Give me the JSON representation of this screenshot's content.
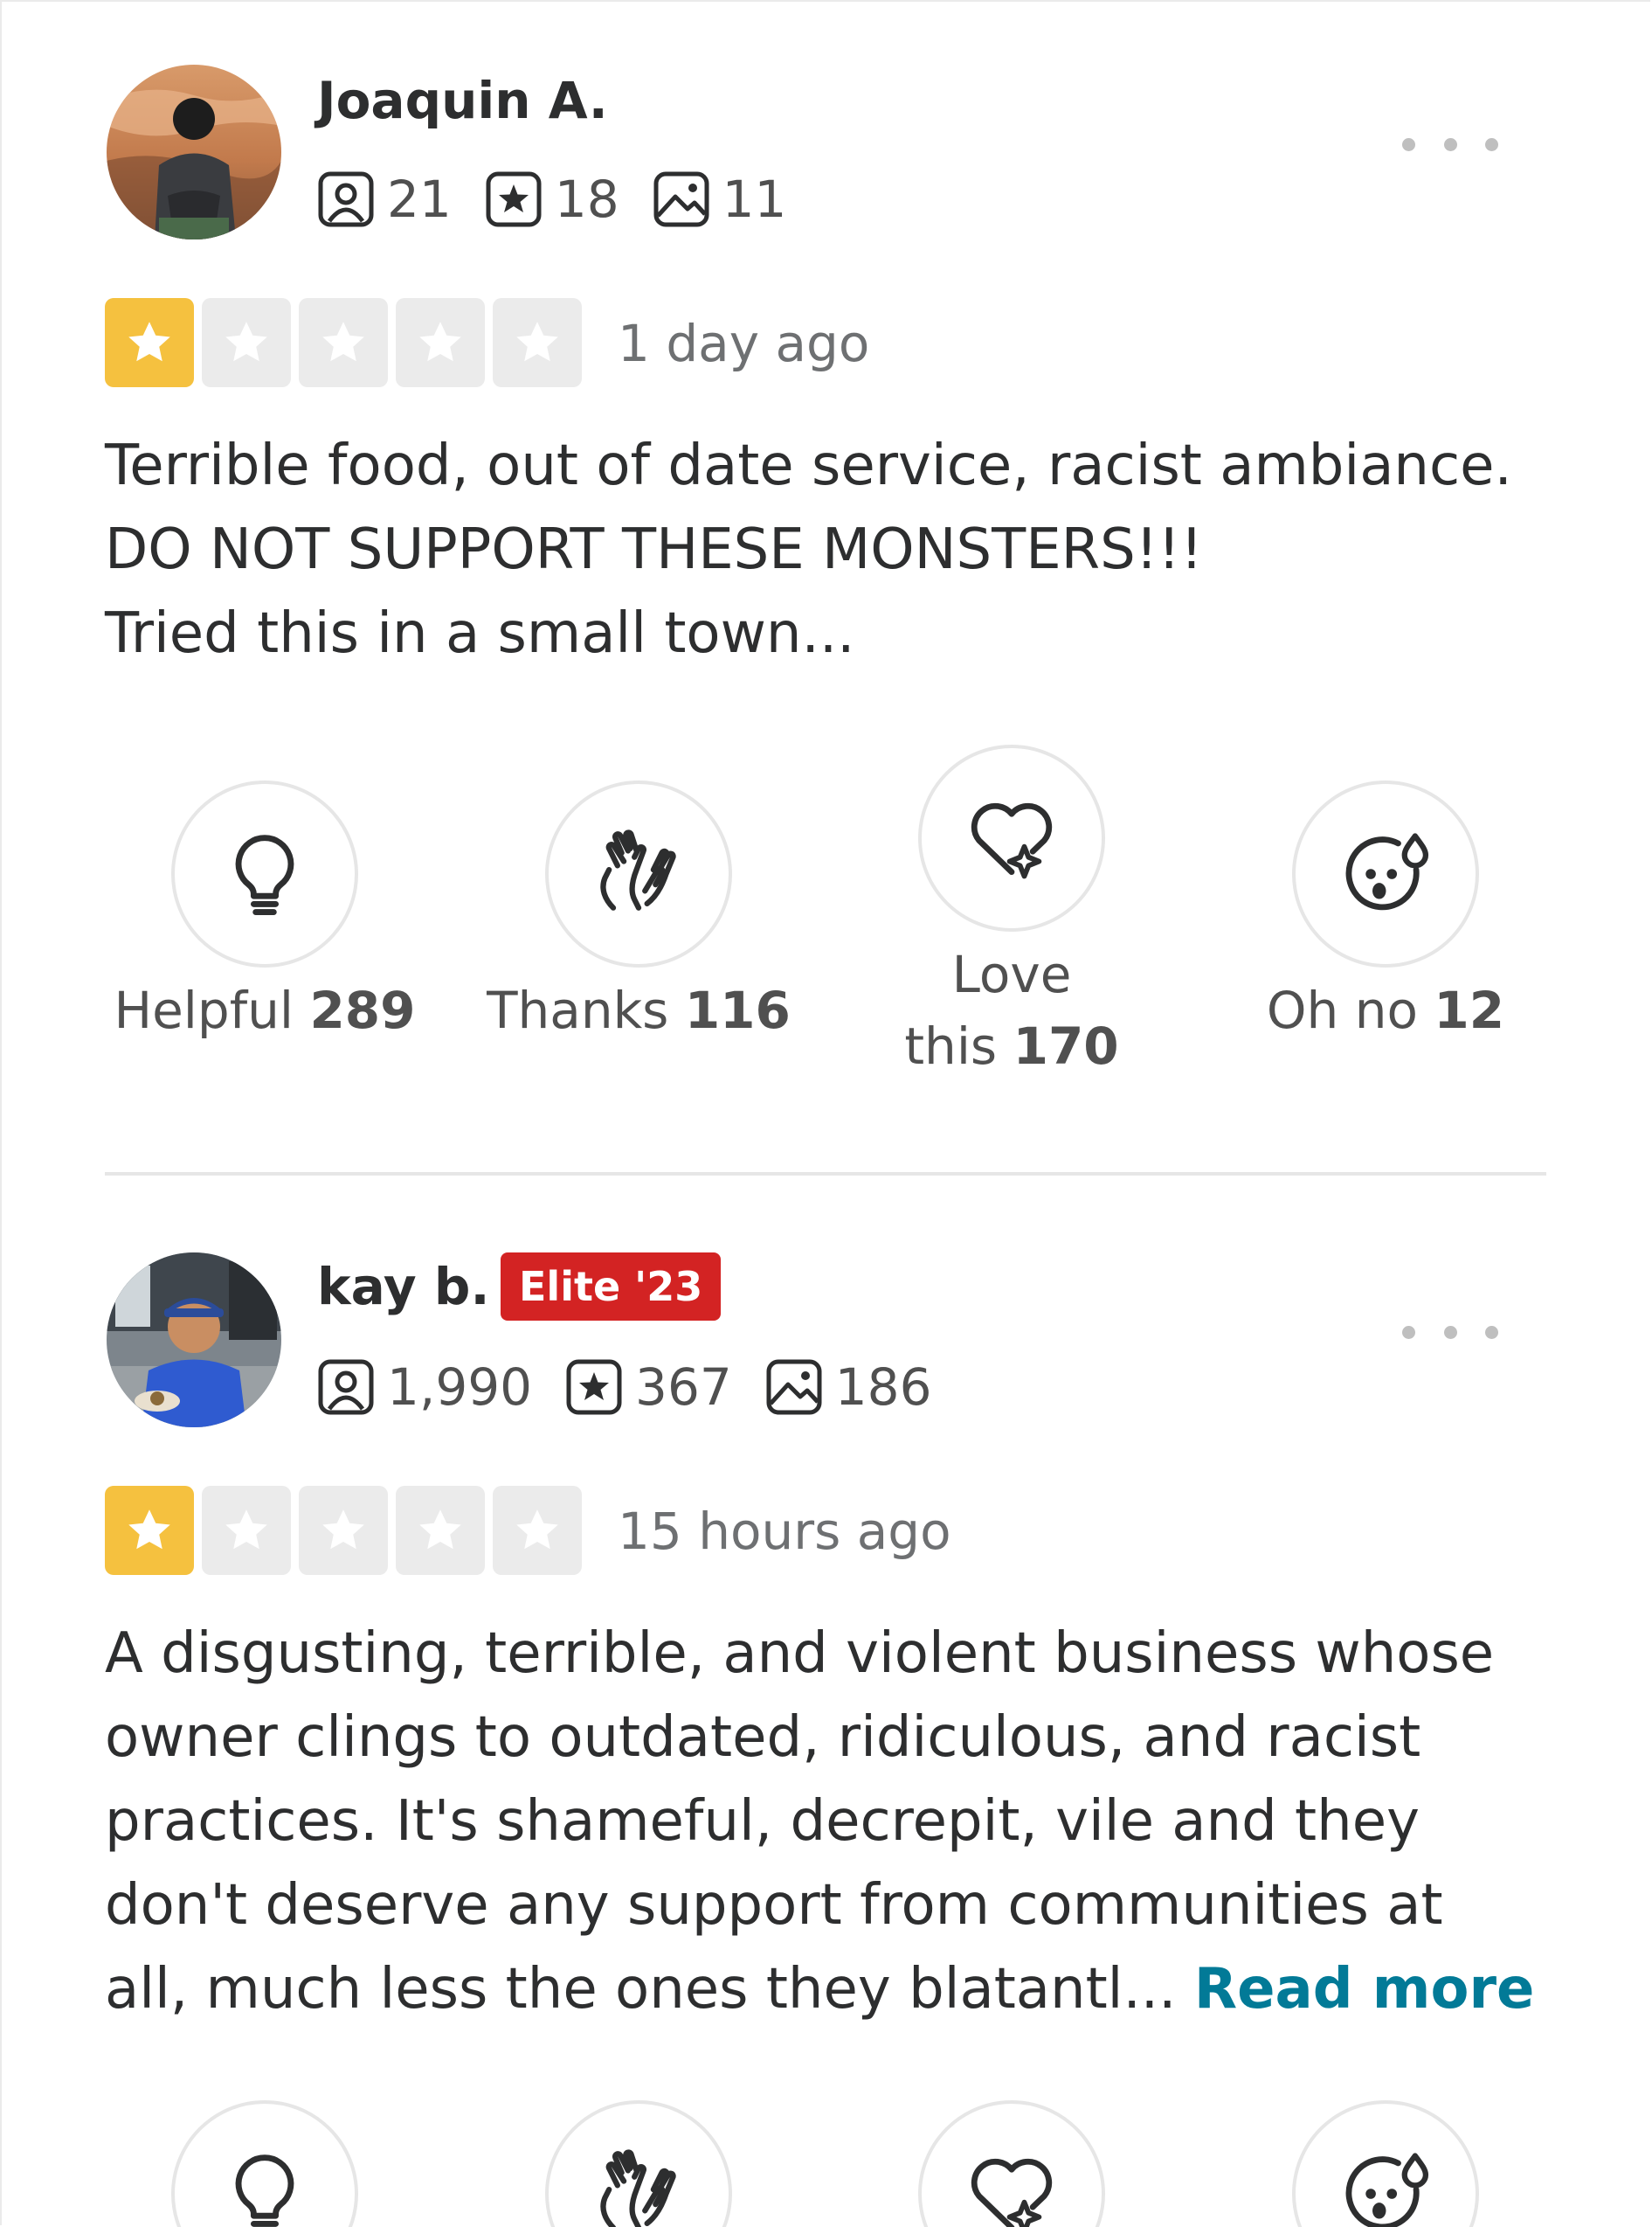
{
  "colors": {
    "star_on": "#f5c13f",
    "star_off": "#ebebeb",
    "elite_badge": "#d32323",
    "link": "#027a97"
  },
  "reviews": [
    {
      "user": {
        "name": "Joaquin A.",
        "elite": null,
        "friends": "21",
        "reviews": "18",
        "photos": "11"
      },
      "rating": 1,
      "date": "1 day ago",
      "text_lines": [
        "Terrible food, out of date service, racist ambiance.",
        "DO NOT SUPPORT THESE MONSTERS!!!",
        "Tried this in a small town..."
      ],
      "reactions": {
        "helpful_label": "Helpful",
        "helpful_count": "289",
        "thanks_label": "Thanks",
        "thanks_count": "116",
        "love_label_1": "Love",
        "love_label_2": "this",
        "love_count": "170",
        "ohno_label": "Oh no",
        "ohno_count": "12"
      }
    },
    {
      "user": {
        "name": "kay b.",
        "elite": "Elite '23",
        "friends": "1,990",
        "reviews": "367",
        "photos": "186"
      },
      "rating": 1,
      "date": "15 hours ago",
      "text_lines": [
        "A disgusting, terrible, and violent business whose",
        "owner clings to outdated, ridiculous, and racist",
        "practices. It's shameful, decrepit, vile and they",
        "don't deserve any support from communities at",
        "all, much less the ones they blatantl..."
      ],
      "read_more": "Read more"
    }
  ]
}
